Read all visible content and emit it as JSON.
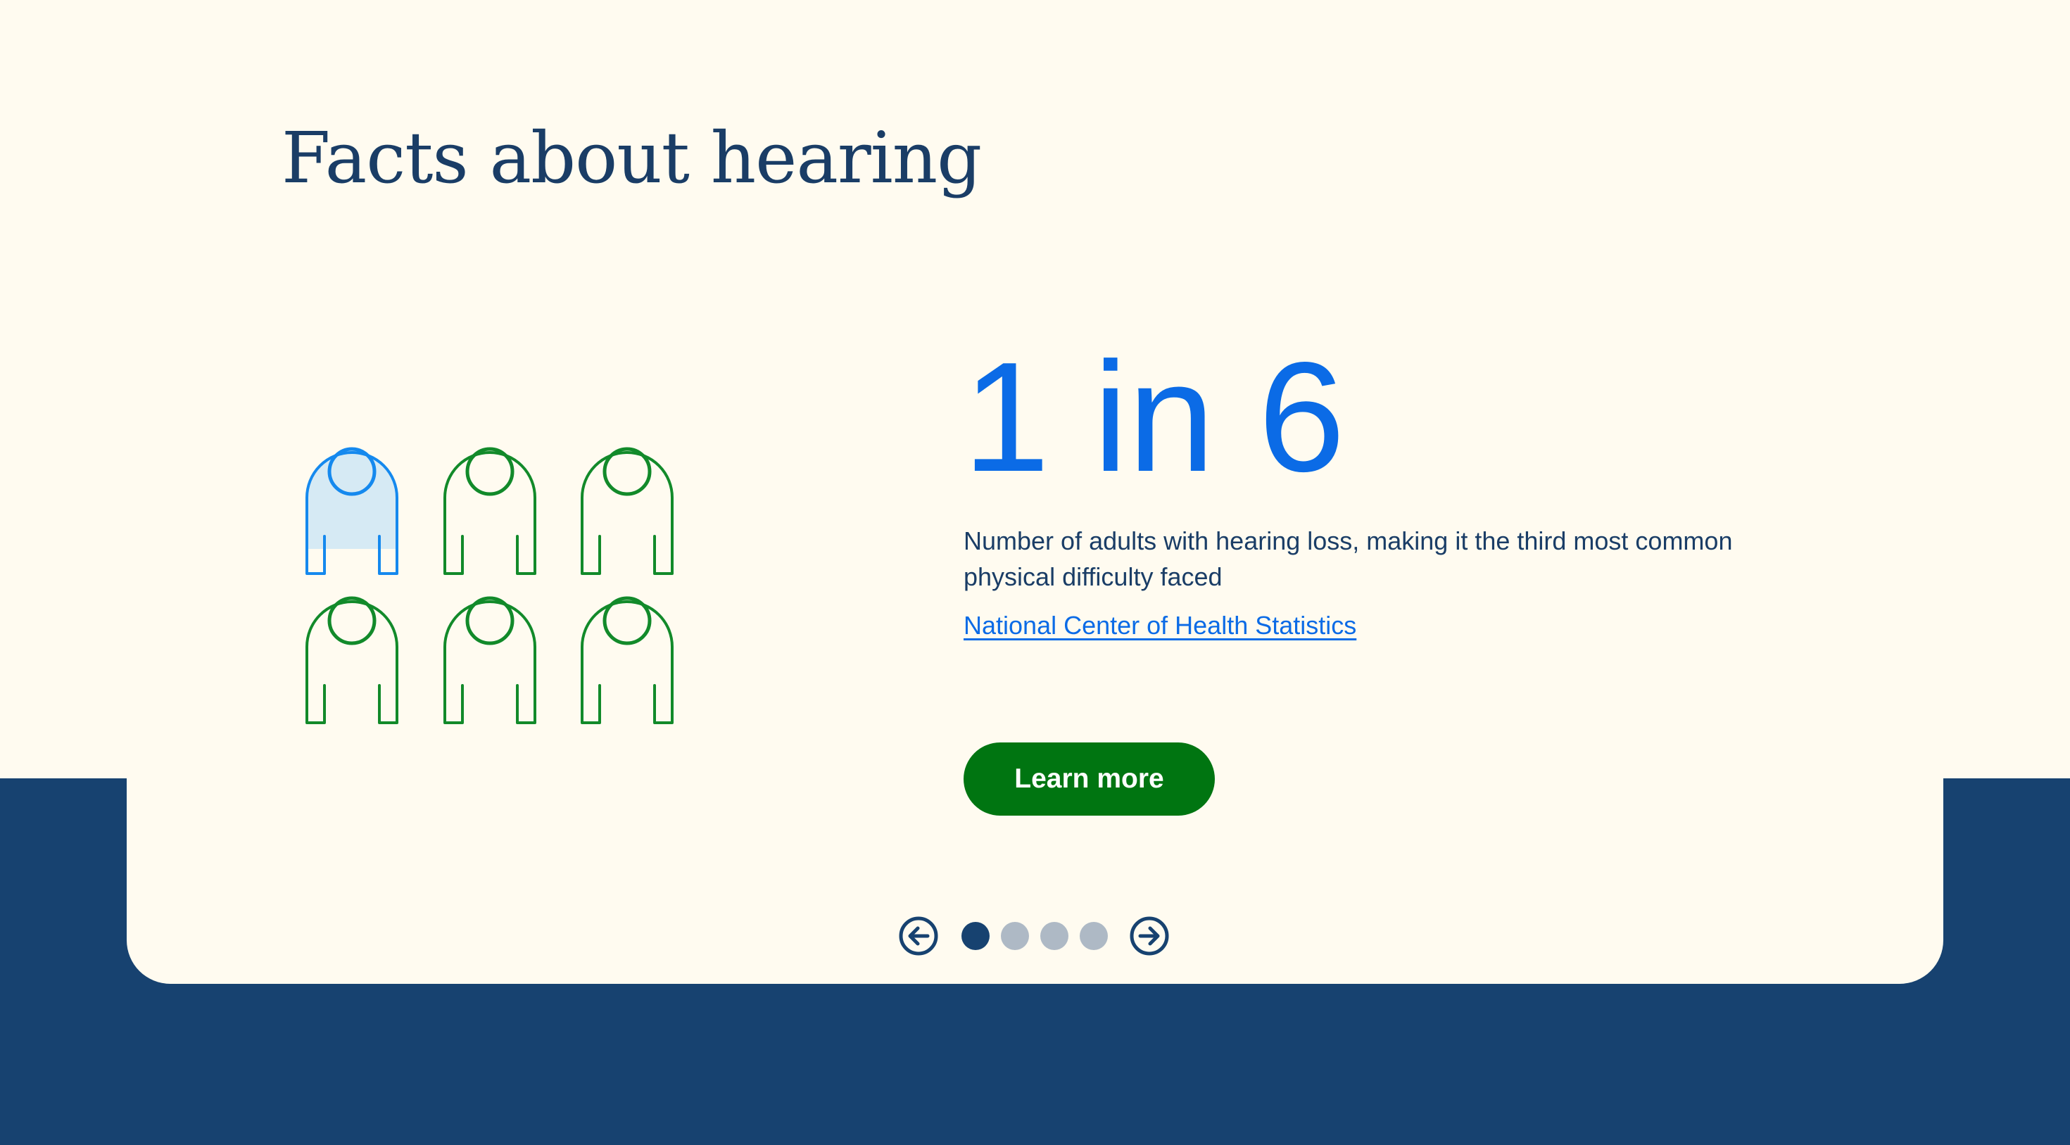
{
  "section": {
    "heading": "Facts about hearing"
  },
  "fact": {
    "stat": "1 in 6",
    "description": "Number of adults with hearing loss, making it the third most common physical difficulty faced",
    "source_link": "National Center of Health Statistics",
    "cta_label": "Learn more"
  },
  "illustration": {
    "people_total": 6,
    "people_highlighted": 1,
    "icon": "person-icon"
  },
  "carousel": {
    "slide_count": 4,
    "active_slide": 1,
    "prev_icon": "arrow-left-circle-icon",
    "next_icon": "arrow-right-circle-icon"
  },
  "colors": {
    "background": "#fffbf0",
    "navy": "#174270",
    "heading": "#1a3d66",
    "accent_blue": "#0b6be6",
    "highlight_person": "#1589ee",
    "highlight_fill": "#d6eaf4",
    "person_green": "#128a2a",
    "button_green": "#007511",
    "dot_inactive": "#aeb9c5"
  }
}
